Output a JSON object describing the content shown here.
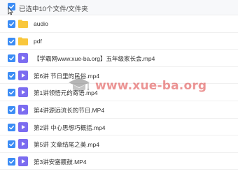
{
  "header": {
    "selection_text": "已选中10个文件/文件夹"
  },
  "items": [
    {
      "type": "folder",
      "name": "audio"
    },
    {
      "type": "folder",
      "name": "pdf"
    },
    {
      "type": "video",
      "name": "【学霸网www.xue-ba.org】五年级家长会.mp4"
    },
    {
      "type": "video",
      "name": "第6讲 节日里的民俗.mp4"
    },
    {
      "type": "video",
      "name": "第1讲领悟元的寄语.mp4"
    },
    {
      "type": "video",
      "name": "第4讲源远流长的节日.MP4"
    },
    {
      "type": "video",
      "name": "第2讲 中心思想巧概括.mp4"
    },
    {
      "type": "video",
      "name": "第5讲 文章结尾之美.mp4"
    },
    {
      "type": "video",
      "name": "第3讲安塞腰鼓.MP4"
    }
  ],
  "watermark": {
    "text": "www.xue-ba.org"
  },
  "colors": {
    "checkbox": "#3b8cf5",
    "folder": "#f9c73c",
    "video": "#7b6cf0",
    "watermark": "#dc3c3c"
  }
}
